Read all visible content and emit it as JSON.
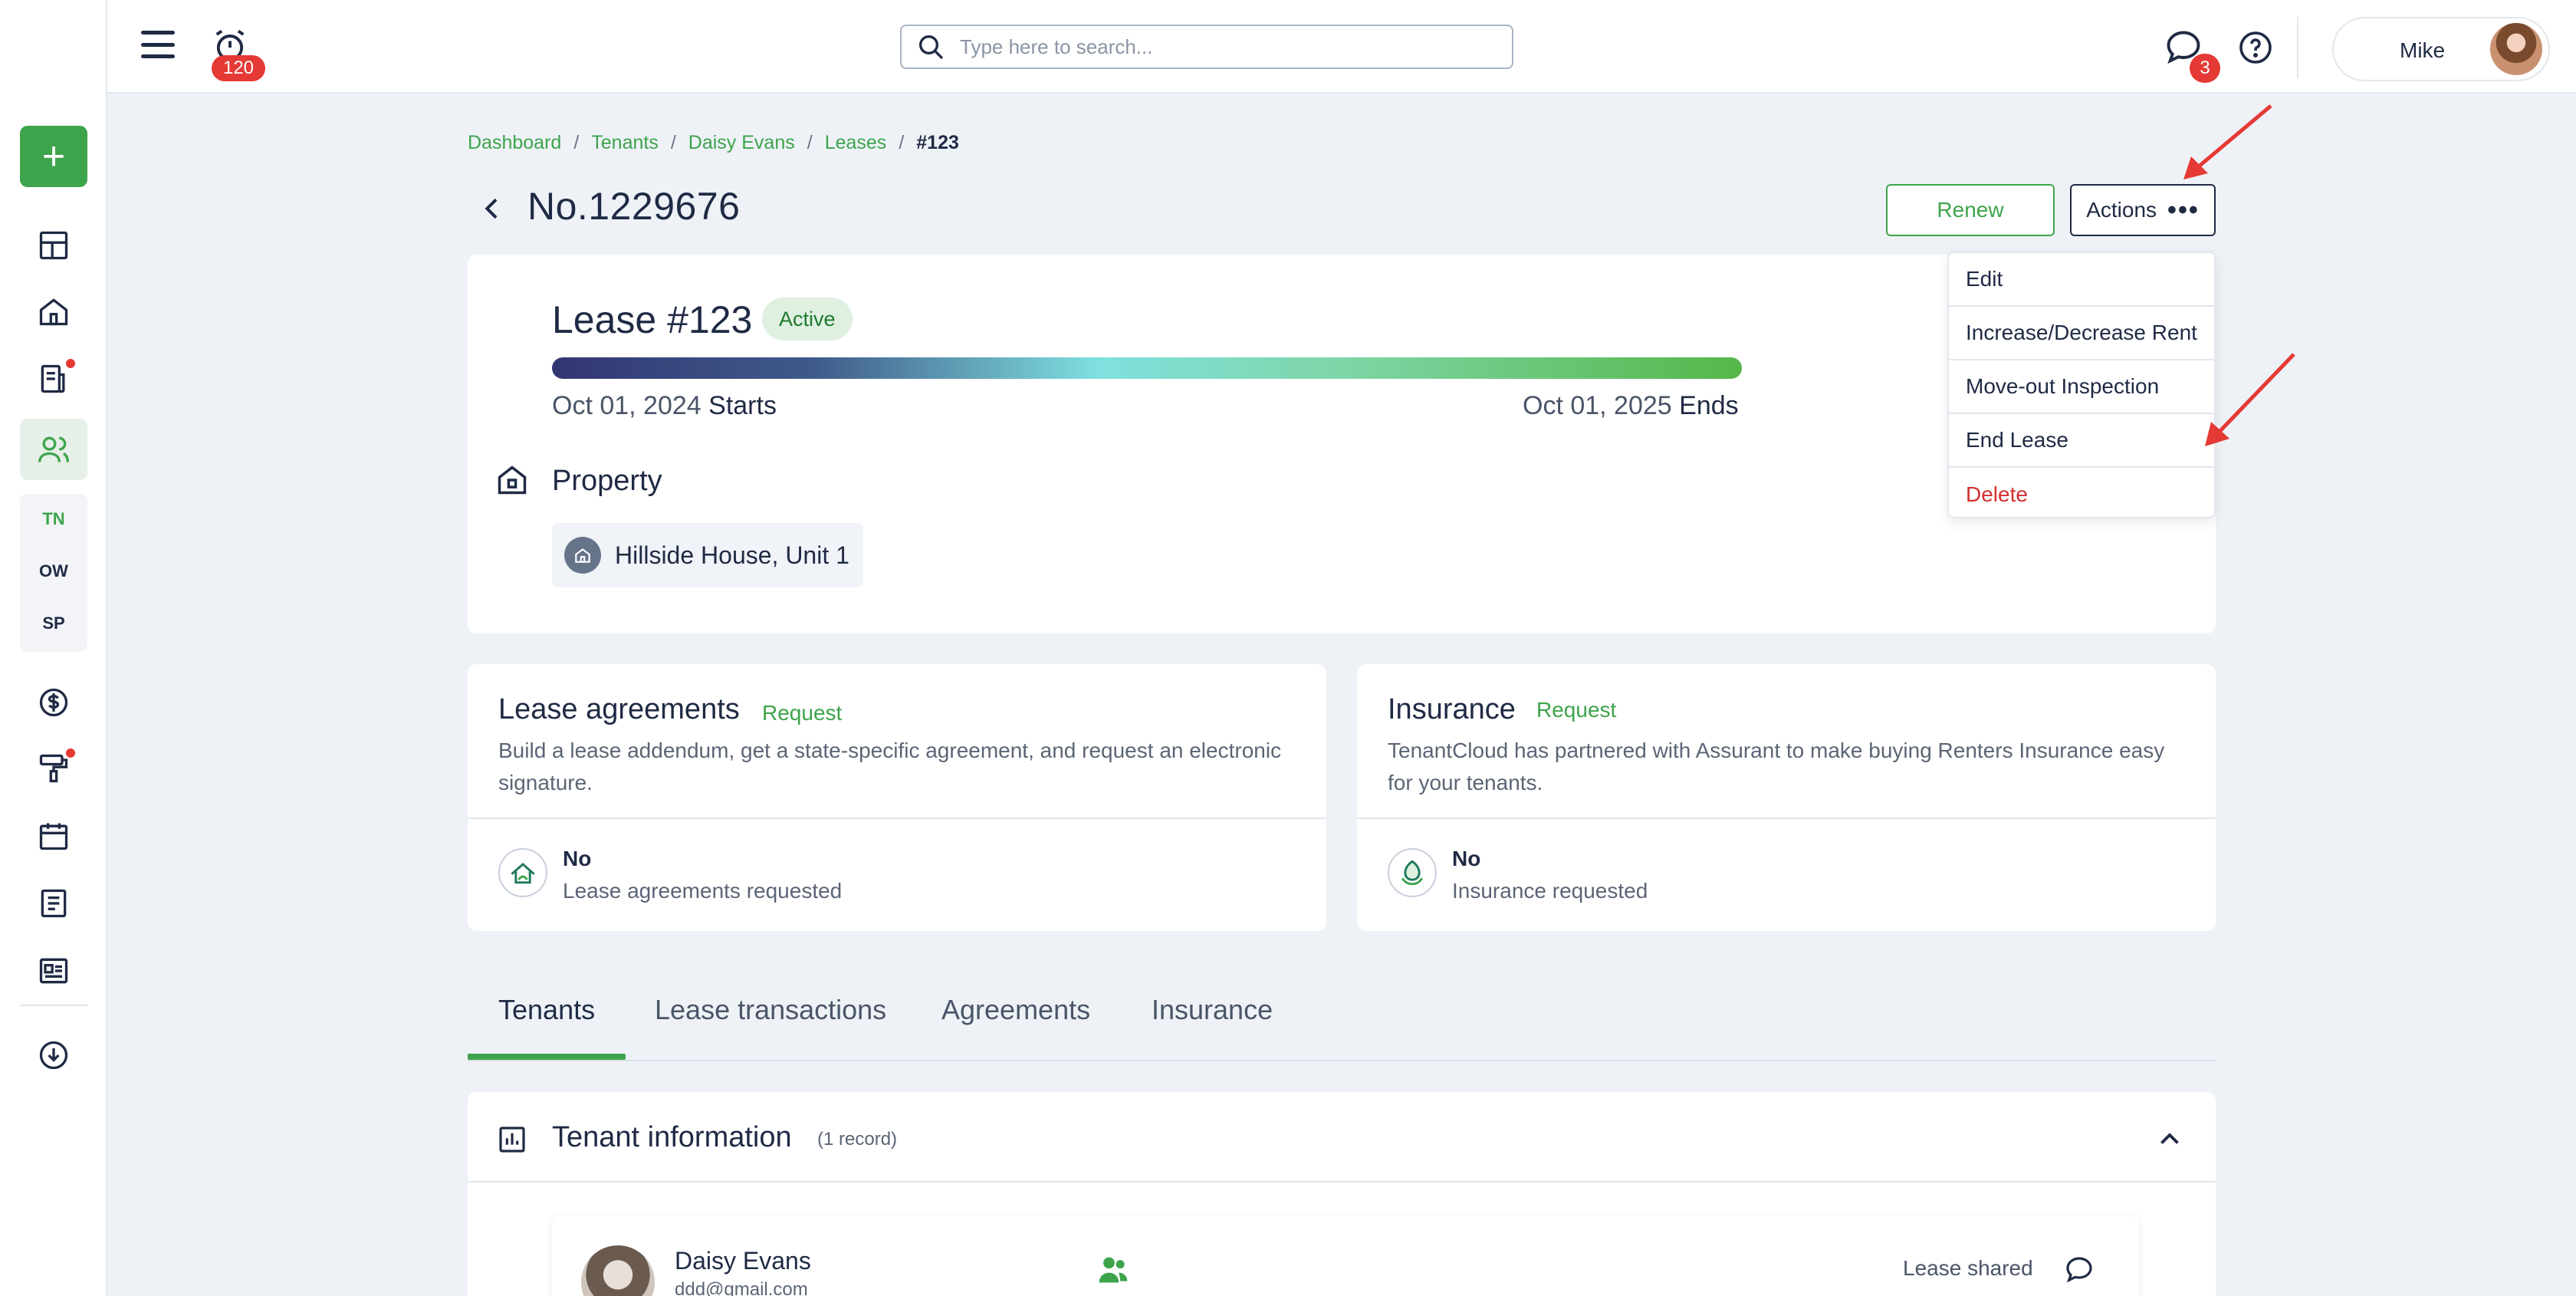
{
  "topbar": {
    "notifications_count": "120",
    "search_placeholder": "Type here to search...",
    "messages_count": "3",
    "user_name": "Mike"
  },
  "sidebar": {
    "add_label": "+",
    "abbreviations": [
      "TN",
      "OW",
      "SP"
    ]
  },
  "breadcrumb": {
    "items": [
      "Dashboard",
      "Tenants",
      "Daisy Evans",
      "Leases"
    ],
    "separator": "/",
    "current": "#123"
  },
  "page": {
    "title": "No.1229676",
    "renew_label": "Renew",
    "actions_label": "Actions"
  },
  "actions_menu": {
    "items": [
      "Edit",
      "Increase/Decrease Rent",
      "Move-out Inspection",
      "End Lease",
      "Delete"
    ]
  },
  "lease": {
    "heading": "Lease #123",
    "status": "Active",
    "start_date": "Oct 01, 2024",
    "start_suffix": "Starts",
    "end_date": "Oct 01, 2025",
    "end_suffix": "Ends",
    "property_label": "Property",
    "property_name": "Hillside House, Unit 1"
  },
  "cards": {
    "agreements": {
      "title": "Lease agreements",
      "request": "Request",
      "description": "Build a lease addendum, get a state-specific agreement, and request an electronic signature.",
      "status": "No",
      "status_sub": "Lease agreements requested"
    },
    "insurance": {
      "title": "Insurance",
      "request": "Request",
      "description": "TenantCloud has partnered with Assurant to make buying Renters Insurance easy for your tenants.",
      "status": "No",
      "status_sub": "Insurance requested"
    }
  },
  "tabs": [
    "Tenants",
    "Lease transactions",
    "Agreements",
    "Insurance"
  ],
  "tenant_info": {
    "title": "Tenant information",
    "count": "(1 record)",
    "tenant_name": "Daisy Evans",
    "tenant_email": "ddd@gmail.com",
    "lease_shared": "Lease shared"
  },
  "colors": {
    "brand_green": "#3da44b",
    "danger_red": "#d32f2f",
    "text_dark": "#1f2a44",
    "background": "#eef2f7"
  }
}
